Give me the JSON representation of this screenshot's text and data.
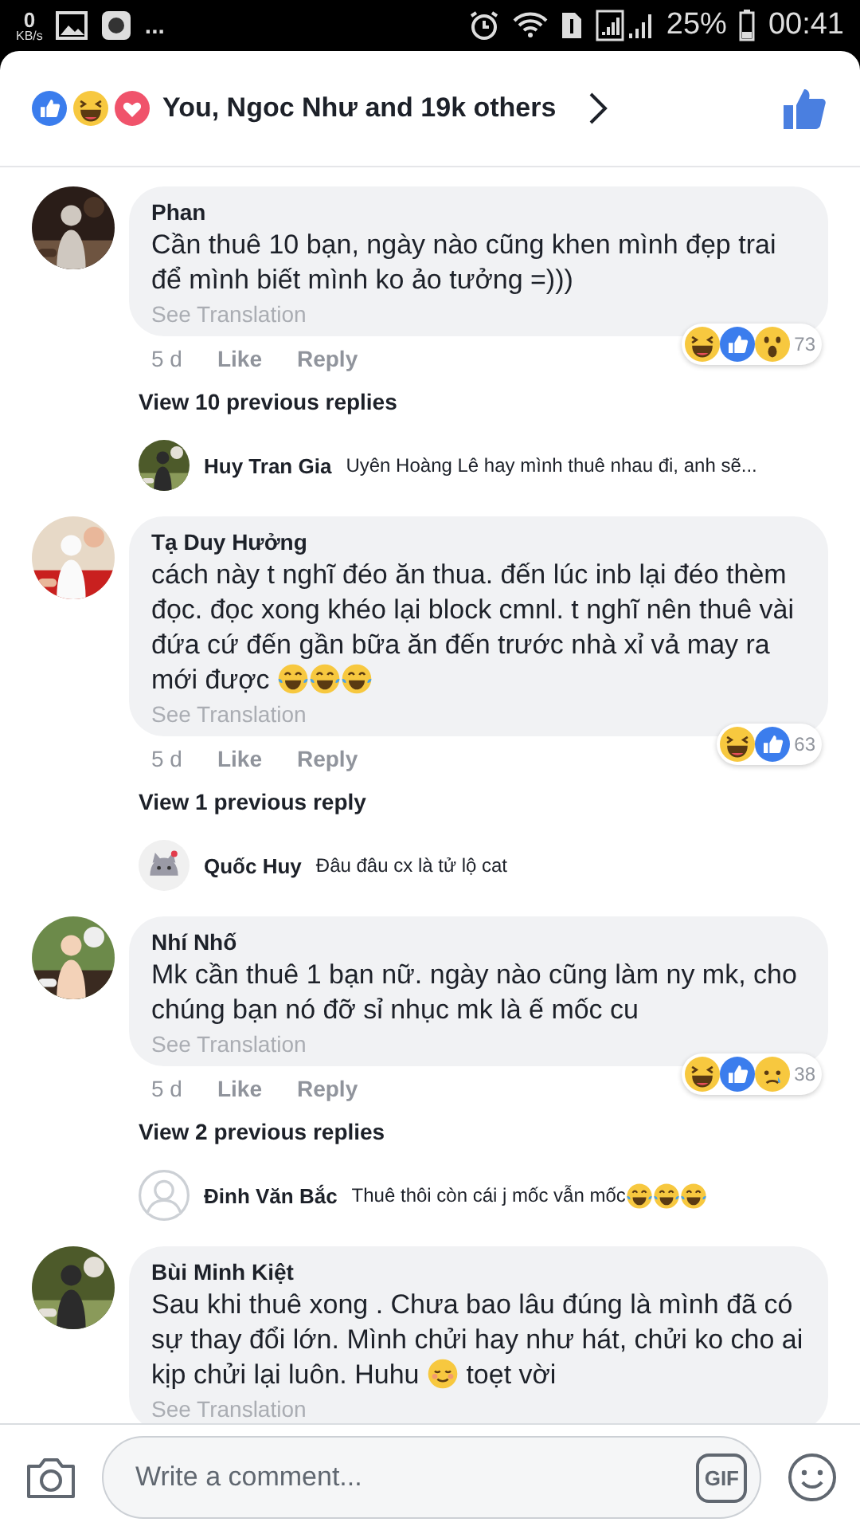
{
  "status_bar": {
    "speed": "0",
    "speed_unit": "KB/s",
    "more": "...",
    "battery": "25%",
    "time": "00:41"
  },
  "reactions_header": {
    "reactions": [
      {
        "kind": "like"
      },
      {
        "kind": "haha"
      },
      {
        "kind": "love"
      }
    ],
    "summary": "You, Ngoc Như and 19k others",
    "liked": true
  },
  "comments": [
    {
      "name": "Phan",
      "avatar": {
        "kind": "picture"
      },
      "body": [
        {
          "kind": "text",
          "text": "Cần thuê 10 bạn, ngày nào cũng khen mình đẹp trai để mình biết mình ko ảo tưởng =)))"
        }
      ],
      "translate": "See Translation",
      "time": "5 d",
      "like": "Like",
      "reply": "Reply",
      "reactions": [
        {
          "kind": "haha"
        },
        {
          "kind": "like"
        },
        {
          "kind": "wow"
        }
      ],
      "reaction_count": "73",
      "view_replies": "View 10 previous replies",
      "latest_reply": {
        "name": "Huy Tran Gia",
        "avatar": {
          "kind": "picture"
        },
        "text": "Uyên Hoàng Lê hay mình thuê nhau đi, anh sẽ..."
      }
    },
    {
      "name": "Tạ Duy Hưởng",
      "avatar": {
        "kind": "picture"
      },
      "body": [
        {
          "kind": "text",
          "text": "cách này t nghĩ đéo ăn thua. đến lúc inb lại đéo thèm đọc. đọc xong khéo lại block cmnl. t nghĩ nên thuê vài đứa cứ đến gần bữa ăn đến trước nhà xỉ vả may ra mới được "
        },
        {
          "kind": "tears"
        },
        {
          "kind": "tears"
        },
        {
          "kind": "tears"
        }
      ],
      "translate": "See Translation",
      "time": "5 d",
      "like": "Like",
      "reply": "Reply",
      "reactions": [
        {
          "kind": "haha"
        },
        {
          "kind": "like"
        }
      ],
      "reaction_count": "63",
      "view_replies": "View 1 previous reply",
      "latest_reply": {
        "name": "Quốc Huy",
        "avatar": {
          "kind": "cat"
        },
        "text": "Đâu đâu cx là tử lộ cat"
      }
    },
    {
      "name": "Nhí Nhố",
      "avatar": {
        "kind": "picture"
      },
      "body": [
        {
          "kind": "text",
          "text": "Mk cần thuê 1 bạn nữ. ngày nào cũng làm ny mk, cho chúng bạn nó đỡ sỉ nhục mk là ế mốc cu"
        }
      ],
      "translate": "See Translation",
      "time": "5 d",
      "like": "Like",
      "reply": "Reply",
      "reactions": [
        {
          "kind": "haha"
        },
        {
          "kind": "like"
        },
        {
          "kind": "sad"
        }
      ],
      "reaction_count": "38",
      "view_replies": "View 2 previous replies",
      "latest_reply": {
        "name": "Đinh Văn Bắc",
        "avatar": {
          "kind": "silhouette"
        },
        "text": "Thuê thôi còn cái j mốc vẫn mốc ",
        "emojis": [
          {
            "kind": "tears"
          },
          {
            "kind": "tears"
          },
          {
            "kind": "tears"
          }
        ]
      }
    },
    {
      "name": "Bùi Minh Kiệt",
      "avatar": {
        "kind": "picture"
      },
      "body": [
        {
          "kind": "text",
          "text": "Sau khi thuê xong . Chưa bao lâu đúng là mình đã có sự thay đổi lớn. Mình chửi hay như hát, chửi ko cho ai kịp chửi lại luôn. Huhu "
        },
        {
          "kind": "relieved"
        },
        {
          "kind": "text",
          "text": " toẹt vời"
        }
      ],
      "translate": "See Translation"
    }
  ],
  "composer": {
    "placeholder": "Write a comment...",
    "gif": "GIF"
  }
}
